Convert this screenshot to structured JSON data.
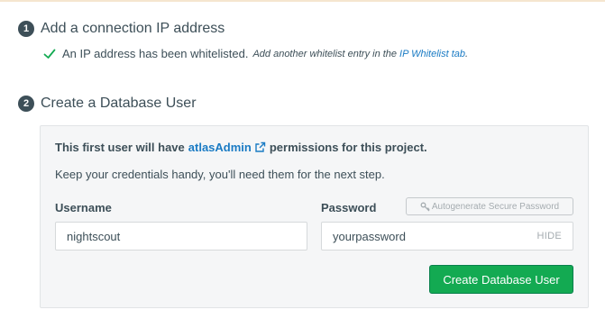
{
  "step1": {
    "number": "1",
    "title": "Add a connection IP address",
    "status_text": "An IP address has been whitelisted.",
    "hint_text": "Add another whitelist entry in the",
    "hint_link": "IP Whitelist tab",
    "hint_suffix": "."
  },
  "step2": {
    "number": "2",
    "title": "Create a Database User",
    "permission_prefix": "This first user will have",
    "permission_link": "atlasAdmin",
    "permission_suffix": "permissions for this project.",
    "credentials_note": "Keep your credentials handy, you'll need them for the next step.",
    "username_label": "Username",
    "username_value": "nightscout",
    "password_label": "Password",
    "password_value": "yourpassword",
    "password_toggle": "HIDE",
    "autogenerate_label": "Autogenerate Secure Password",
    "create_button": "Create Database User"
  },
  "colors": {
    "accent_green": "#13aa52",
    "link_blue": "#1a7bc4",
    "text": "#3d4f58"
  },
  "icons": {
    "check": "check-icon",
    "external": "external-link-icon",
    "key": "key-icon"
  }
}
